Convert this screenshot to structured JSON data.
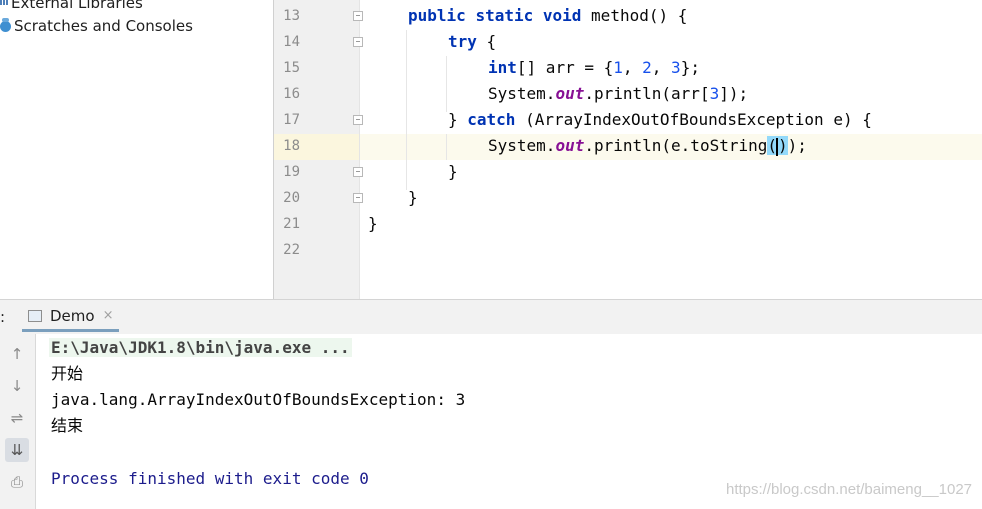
{
  "project_tree": {
    "items": [
      {
        "label": "External Libraries",
        "icon": "library-icon"
      },
      {
        "label": "Scratches and Consoles",
        "icon": "scratch-icon"
      }
    ]
  },
  "editor": {
    "lines": [
      {
        "no": "13",
        "fold": true
      },
      {
        "no": "14",
        "fold": true
      },
      {
        "no": "15",
        "fold": false
      },
      {
        "no": "16",
        "fold": false
      },
      {
        "no": "17",
        "fold": true
      },
      {
        "no": "18",
        "fold": false
      },
      {
        "no": "19",
        "fold": true
      },
      {
        "no": "20",
        "fold": true
      },
      {
        "no": "21",
        "fold": false
      },
      {
        "no": "22",
        "fold": false
      }
    ],
    "tokens": {
      "l13": {
        "kw1": "public",
        "kw2": "static",
        "kw3": "void",
        "rest": "method() {"
      },
      "l14": {
        "kw": "try",
        "rest": "{"
      },
      "l15": {
        "kw": "int",
        "a": "[] arr = {",
        "n1": "1",
        "c1": ", ",
        "n2": "2",
        "c2": ", ",
        "n3": "3",
        "end": "};"
      },
      "l16": {
        "a": "System.",
        "fld": "out",
        "b": ".println(arr[",
        "n": "3",
        "c": "]);"
      },
      "l17": {
        "a": "} ",
        "kw": "catch",
        "b": " (ArrayIndexOutOfBoundsException e) {"
      },
      "l18": {
        "a": "System.",
        "fld": "out",
        "b": ".println(e.toString",
        "p1": "(",
        "p2": ")",
        "c": ");"
      },
      "l19": {
        "a": "}"
      },
      "l20": {
        "a": "}"
      },
      "l21": {
        "a": "}"
      }
    }
  },
  "run_panel": {
    "colon": ":",
    "tab_label": "Demo",
    "tab_close": "×",
    "toolbar": [
      {
        "name": "up-arrow-icon",
        "glyph": "↑"
      },
      {
        "name": "down-arrow-icon",
        "glyph": "↓"
      },
      {
        "name": "soft-wrap-icon",
        "glyph": "⇌"
      },
      {
        "name": "scroll-to-end-icon",
        "glyph": "⇊"
      },
      {
        "name": "print-icon",
        "glyph": "⎙"
      }
    ],
    "console": {
      "command": "E:\\Java\\JDK1.8\\bin\\java.exe ...",
      "out1": "开始",
      "out2": "java.lang.ArrayIndexOutOfBoundsException: 3",
      "out3": "结束",
      "process": "Process finished with exit code 0"
    },
    "watermark": "https://blog.csdn.net/baimeng__1027"
  }
}
